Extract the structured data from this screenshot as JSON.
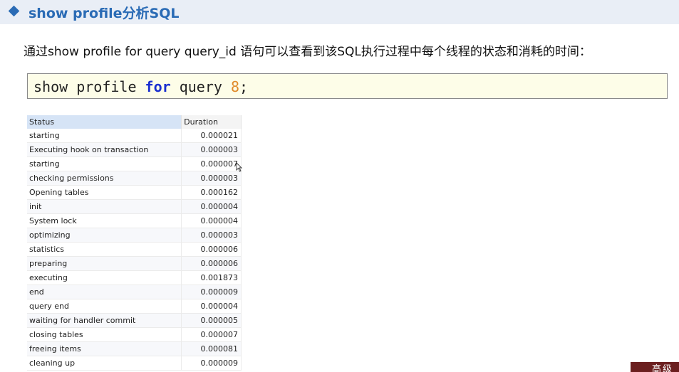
{
  "header": {
    "title": "show profile分析SQL"
  },
  "intro": {
    "text": "通过show  profile for  query  query_id 语句可以查看到该SQL执行过程中每个线程的状态和消耗的时间："
  },
  "code": {
    "part1": "show profile ",
    "keyword": "for",
    "part2": " query ",
    "number": "8",
    "end": ";"
  },
  "table": {
    "columns": [
      "Status",
      "Duration"
    ],
    "rows": [
      {
        "status": "starting",
        "duration": "0.000021"
      },
      {
        "status": "Executing hook on transaction",
        "duration": "0.000003"
      },
      {
        "status": "starting",
        "duration": "0.000007"
      },
      {
        "status": "checking permissions",
        "duration": "0.000003"
      },
      {
        "status": "Opening tables",
        "duration": "0.000162"
      },
      {
        "status": "init",
        "duration": "0.000004"
      },
      {
        "status": "System lock",
        "duration": "0.000004"
      },
      {
        "status": "optimizing",
        "duration": "0.000003"
      },
      {
        "status": "statistics",
        "duration": "0.000006"
      },
      {
        "status": "preparing",
        "duration": "0.000006"
      },
      {
        "status": "executing",
        "duration": "0.001873"
      },
      {
        "status": "end",
        "duration": "0.000009"
      },
      {
        "status": "query end",
        "duration": "0.000004"
      },
      {
        "status": "waiting for handler commit",
        "duration": "0.000005"
      },
      {
        "status": "closing tables",
        "duration": "0.000007"
      },
      {
        "status": "freeing items",
        "duration": "0.000081"
      },
      {
        "status": "cleaning up",
        "duration": "0.000009"
      }
    ]
  },
  "badge": {
    "text": "高级"
  },
  "icons": {
    "bullet": "diamond-bullet-icon",
    "cursor": "mouse-pointer-icon"
  },
  "colors": {
    "accent": "#2a6bb5",
    "keyword": "#1a2fd0",
    "number": "#e08a2a",
    "code_bg": "#fdfde8",
    "badge_bg": "#6b1f1f"
  }
}
